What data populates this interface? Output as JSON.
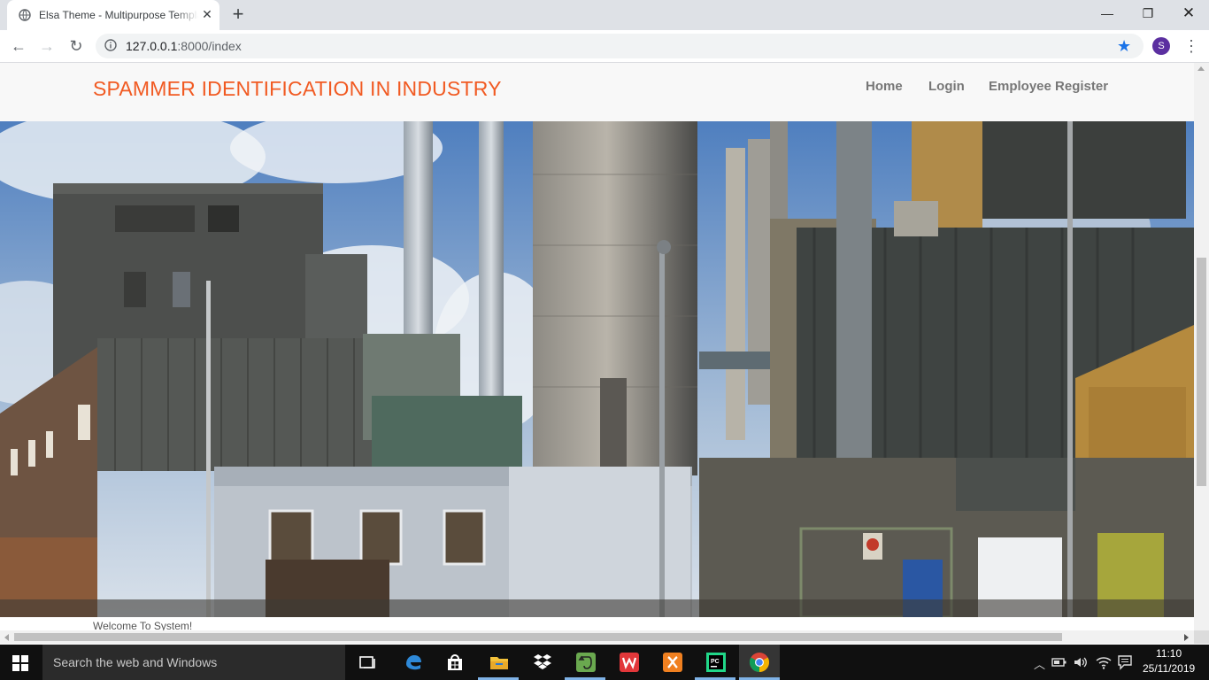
{
  "browser": {
    "tab_title": "Elsa Theme - Multipurpose Template",
    "new_tab_icon": "plus-icon",
    "url_host": "127.0.0.1",
    "url_rest": ":8000/index",
    "profile_initial": "S",
    "profile_color": "#5b2fa0"
  },
  "site": {
    "brand": "SPAMMER IDENTIFICATION IN INDUSTRY",
    "brand_color": "#f15a22",
    "nav": [
      "Home",
      "Login",
      "Employee Register"
    ],
    "hero_image": "industrial-plant-photo",
    "welcome": "Welcome To System!"
  },
  "taskbar": {
    "search_placeholder": "Search the web and Windows",
    "apps": [
      "task-view",
      "edge",
      "store",
      "file-explorer",
      "dropbox",
      "evernote",
      "wps-office",
      "xampp",
      "pycharm",
      "chrome"
    ],
    "time": "11:10",
    "date": "25/11/2019"
  }
}
